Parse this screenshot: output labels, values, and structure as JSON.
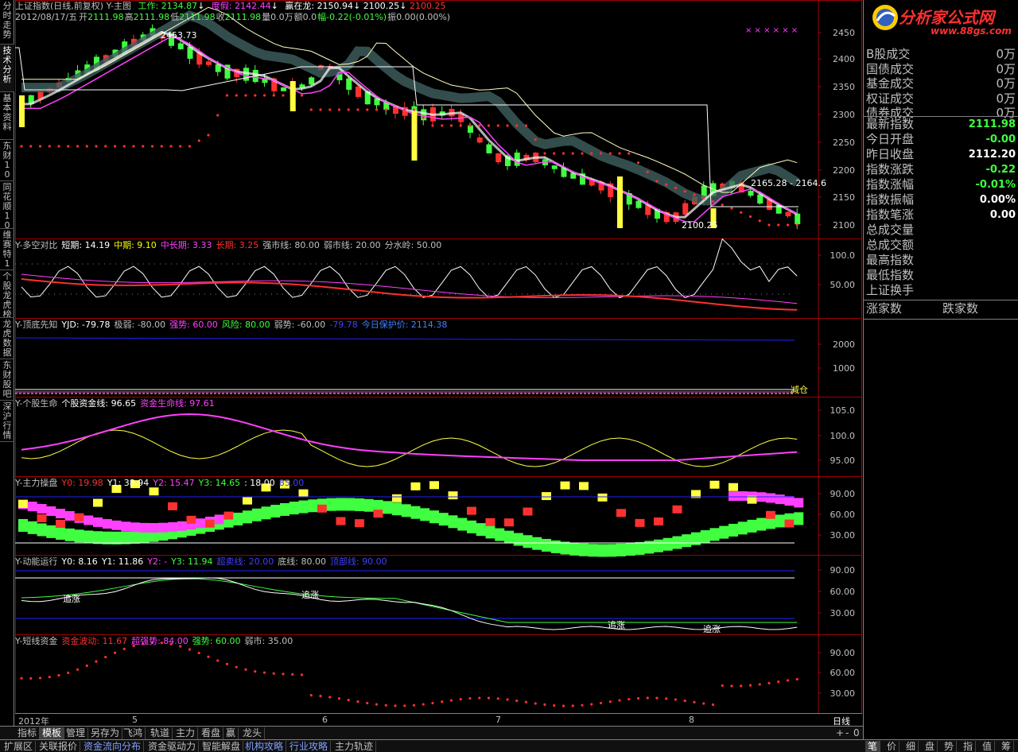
{
  "left_tabs": [
    "分时走势",
    "技术分析",
    "基本资料",
    "东财10",
    "同花顺10",
    "维赛特10",
    "个股龙虎榜",
    "龙虎数据",
    "东财股吧",
    "深沪行情"
  ],
  "main_header": {
    "title": "上证指数(日线,前复权) Y-主图",
    "work_label": "工作:",
    "work_value": "2134.87",
    "fake_label": "度假:",
    "fake_value": "2142.44",
    "win_label": "赢在龙:",
    "win_values": [
      "2150.94",
      "2100.25",
      "2100.25"
    ],
    "ohlc_line": "2012/08/17/五",
    "open_label": "开",
    "open_value": "2111.98",
    "high_label": "高",
    "high_value": "2111.98",
    "low_label": "低",
    "low_value": "2111.98",
    "close_label": "收",
    "close_value": "2111.98",
    "vol_label": "量0.0万",
    "amt_label": "额0.0",
    "change_label": "幅-0.22(-0.01%)",
    "amp_label": "振0.00(0.00%)"
  },
  "main_chart": {
    "y_ticks": [
      "2450",
      "2400",
      "2350",
      "2300",
      "2250",
      "2200",
      "2150",
      "2100"
    ],
    "annot_high": "2453.73",
    "annot_low": "2100.25",
    "annot_range": "2165.28 - 2164.6",
    "x_stars": "× × × × × ×"
  },
  "panel2": {
    "title": "Y-多空对比",
    "items": [
      {
        "label": "短期: 14.19",
        "color": "#ffffff"
      },
      {
        "label": "中期: 9.10",
        "color": "#ffff00"
      },
      {
        "label": "中长期: 3.33",
        "color": "#ff40ff"
      },
      {
        "label": "长期: 3.25",
        "color": "#ff3030"
      },
      {
        "label": "强市线: 80.00",
        "color": "#c0c0c0"
      },
      {
        "label": "弱市线: 20.00",
        "color": "#c0c0c0"
      },
      {
        "label": "分水岭: 50.00",
        "color": "#c0c0c0"
      }
    ],
    "y_ticks": [
      "100.0",
      "50.00"
    ]
  },
  "panel3": {
    "title": "Y-顶底先知",
    "items": [
      {
        "label": "YJD: -79.78",
        "color": "#ffffff"
      },
      {
        "label": "极弱: -80.00",
        "color": "#c0c0c0"
      },
      {
        "label": "强势: 60.00",
        "color": "#ff40ff"
      },
      {
        "label": "风险: 80.00",
        "color": "#40ff40"
      },
      {
        "label": "弱势: -60.00",
        "color": "#c0c0c0"
      },
      {
        "label": "-79.78",
        "color": "#4040ff"
      },
      {
        "label": "今日保护价: 2114.38",
        "color": "#4080ff"
      }
    ],
    "y_ticks": [
      "2000",
      "1000"
    ],
    "tag": "减仓"
  },
  "panel4": {
    "title": "Y-个股生命",
    "items": [
      {
        "label": "个股资金线: 96.65",
        "color": "#ffffff"
      },
      {
        "label": "资金生命线: 97.61",
        "color": "#ff40ff"
      }
    ],
    "y_ticks": [
      "105.0",
      "100.0",
      "95.00"
    ]
  },
  "panel5": {
    "title": "Y-主力操盘",
    "items": [
      {
        "label": "Y0: 19.98",
        "color": "#ff3030"
      },
      {
        "label": "Y1: 38.94",
        "color": "#ffffff"
      },
      {
        "label": "Y2: 15.47",
        "color": "#ff40ff"
      },
      {
        "label": "Y3: 14.65",
        "color": "#40ff40"
      },
      {
        "label": ": 18.00",
        "color": "#ffffff"
      },
      {
        "label": "85.00",
        "color": "#4040ff"
      }
    ],
    "y_ticks": [
      "90.00",
      "60.00",
      "30.00"
    ]
  },
  "panel6": {
    "title": "Y-动能运行",
    "items": [
      {
        "label": "Y0: 8.16",
        "color": "#ffffff"
      },
      {
        "label": "Y1: 11.86",
        "color": "#ffffff"
      },
      {
        "label": "Y2: -",
        "color": "#ff40ff"
      },
      {
        "label": "Y3: 11.94",
        "color": "#40ff40"
      },
      {
        "label": "超卖线: 20.00",
        "color": "#4040ff"
      },
      {
        "label": "底线: 80.00",
        "color": "#c0c0c0"
      },
      {
        "label": "顶部线: 90.00",
        "color": "#4040ff"
      }
    ],
    "y_ticks": [
      "90.00",
      "60.00",
      "30.00"
    ],
    "tags": [
      "追涨",
      "追涨",
      "追涨",
      "追涨"
    ]
  },
  "panel7": {
    "title": "Y-短线资金",
    "items": [
      {
        "label": "资金波动: 11.67",
        "color": "#ff3030"
      },
      {
        "label": "超强势: 84.00",
        "color": "#ff40ff"
      },
      {
        "label": "强势: 60.00",
        "color": "#40ff40"
      },
      {
        "label": "弱市: 35.00",
        "color": "#c0c0c0"
      }
    ],
    "y_ticks": [
      "90.00",
      "60.00",
      "30.00"
    ]
  },
  "time_axis": {
    "labels": [
      "2012年",
      "5",
      "6",
      "7",
      "8"
    ],
    "period": "日线"
  },
  "tab_bar1": {
    "items": [
      "指标",
      "模板",
      "管理",
      "另存为",
      "飞鸿",
      "轨道",
      "主力",
      "看盘",
      "赢",
      "龙头"
    ],
    "active": 1,
    "ctrl": [
      "+",
      "-",
      "0"
    ]
  },
  "tab_bar2": {
    "items": [
      "扩展区",
      "关联报价",
      "资金流向分布",
      "资金驱动力",
      "智能解盘",
      "机构攻略",
      "行业攻略",
      "主力轨迹"
    ],
    "right_tabs": [
      "笔",
      "价",
      "细",
      "盘",
      "势",
      "指",
      "值",
      "筹"
    ]
  },
  "logo": {
    "text": "分析家公式网",
    "url": "www.88gs.com"
  },
  "info": {
    "group1": [
      {
        "label": "B股成交",
        "value": "0万"
      },
      {
        "label": "国债成交",
        "value": "0万"
      },
      {
        "label": "基金成交",
        "value": "0万"
      },
      {
        "label": "权证成交",
        "value": "0万"
      },
      {
        "label": "债券成交",
        "value": "0万"
      }
    ],
    "group2": [
      {
        "label": "最新指数",
        "value": "2111.98",
        "color": "#40ff40"
      },
      {
        "label": "今日开盘",
        "value": "-0.00",
        "color": "#40ff40"
      },
      {
        "label": "昨日收盘",
        "value": "2112.20",
        "color": "#ffffff"
      },
      {
        "label": "指数涨跌",
        "value": "-0.22",
        "color": "#40ff40"
      },
      {
        "label": "指数涨幅",
        "value": "-0.01%",
        "color": "#40ff40"
      },
      {
        "label": "指数振幅",
        "value": "0.00%",
        "color": "#ffffff"
      },
      {
        "label": "指数笔涨",
        "value": "0.00",
        "color": "#ffffff"
      },
      {
        "label": "总成交量",
        "value": "",
        "color": "#ffffff"
      },
      {
        "label": "总成交额",
        "value": "",
        "color": "#ffffff"
      },
      {
        "label": "最高指数",
        "value": "",
        "color": "#ffffff"
      },
      {
        "label": "最低指数",
        "value": "",
        "color": "#ffffff"
      },
      {
        "label": "上证换手",
        "value": "",
        "color": "#ffffff"
      }
    ],
    "group3": [
      "涨家数",
      "跌家数"
    ]
  }
}
